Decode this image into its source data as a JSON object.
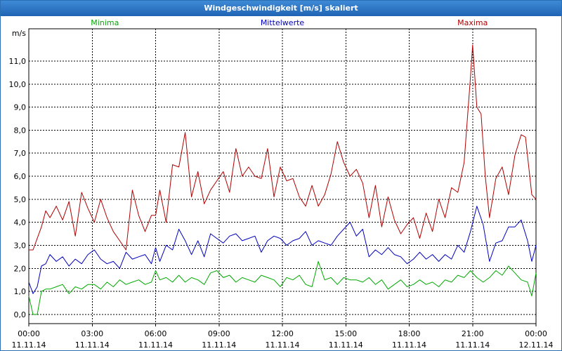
{
  "window": {
    "title": "Windgeschwindigkeit [m/s] skaliert"
  },
  "colors": {
    "minima": "#00aa00",
    "mittelwerte": "#0000c0",
    "maxima": "#b00000",
    "grid": "#000000"
  },
  "chart_data": {
    "type": "line",
    "title": "Windgeschwindigkeit [m/s] skaliert",
    "ylabel": "m/s",
    "xlabel": "",
    "ylim": [
      -0.4,
      12.4
    ],
    "xlim": [
      0,
      24
    ],
    "yticks": [
      0,
      1,
      2,
      3,
      4,
      5,
      6,
      7,
      8,
      9,
      10,
      11
    ],
    "ytick_labels": [
      "0,0",
      "1,0",
      "2,0",
      "3,0",
      "4,0",
      "5,0",
      "6,0",
      "7,0",
      "8,0",
      "9,0",
      "10,0",
      "11,0"
    ],
    "xticks": [
      0,
      3,
      6,
      9,
      12,
      15,
      18,
      21,
      24
    ],
    "xtick_time_labels": [
      "00:00",
      "03:00",
      "06:00",
      "09:00",
      "12:00",
      "15:00",
      "18:00",
      "21:00",
      "00:00"
    ],
    "xtick_date_labels": [
      "11.11.14",
      "11.11.14",
      "11.11.14",
      "11.11.14",
      "11.11.14",
      "11.11.14",
      "11.11.14",
      "11.11.14",
      "12.11.14"
    ],
    "grid": true,
    "series": [
      {
        "name": "Minima",
        "color": "#00aa00",
        "legend_position": "left",
        "x": [
          0,
          0.2,
          0.4,
          0.6,
          0.8,
          1.0,
          1.3,
          1.6,
          1.9,
          2.2,
          2.5,
          2.8,
          3.1,
          3.4,
          3.7,
          4.0,
          4.3,
          4.6,
          4.9,
          5.2,
          5.5,
          5.8,
          6.0,
          6.2,
          6.5,
          6.8,
          7.1,
          7.4,
          7.7,
          8.0,
          8.3,
          8.6,
          8.9,
          9.2,
          9.5,
          9.8,
          10.1,
          10.4,
          10.7,
          11.0,
          11.3,
          11.6,
          11.9,
          12.2,
          12.5,
          12.8,
          13.1,
          13.4,
          13.7,
          14.0,
          14.3,
          14.6,
          14.9,
          15.2,
          15.5,
          15.8,
          16.1,
          16.4,
          16.7,
          17.0,
          17.3,
          17.6,
          17.9,
          18.2,
          18.5,
          18.8,
          19.1,
          19.4,
          19.7,
          20.0,
          20.3,
          20.6,
          20.9,
          21.2,
          21.5,
          21.8,
          22.1,
          22.4,
          22.7,
          23.0,
          23.3,
          23.6,
          23.8,
          24.0
        ],
        "values": [
          0.8,
          0,
          0,
          1.0,
          1.1,
          1.1,
          1.2,
          1.3,
          0.9,
          1.2,
          1.1,
          1.3,
          1.3,
          1.1,
          1.4,
          1.2,
          1.5,
          1.3,
          1.4,
          1.5,
          1.3,
          1.4,
          1.9,
          1.5,
          1.6,
          1.4,
          1.7,
          1.4,
          1.6,
          1.5,
          1.3,
          1.8,
          1.9,
          1.6,
          1.7,
          1.4,
          1.6,
          1.5,
          1.4,
          1.7,
          1.6,
          1.5,
          1.2,
          1.6,
          1.5,
          1.7,
          1.3,
          1.2,
          2.3,
          1.5,
          1.6,
          1.3,
          1.6,
          1.5,
          1.5,
          1.4,
          1.6,
          1.3,
          1.5,
          1.1,
          1.3,
          1.5,
          1.2,
          1.3,
          1.5,
          1.3,
          1.4,
          1.2,
          1.5,
          1.4,
          1.7,
          1.6,
          1.9,
          1.6,
          1.4,
          1.6,
          1.9,
          1.7,
          2.1,
          1.8,
          1.5,
          1.4,
          0.8,
          1.8
        ]
      },
      {
        "name": "Mittelwerte",
        "color": "#0000c0",
        "legend_position": "center",
        "x": [
          0,
          0.2,
          0.4,
          0.6,
          0.8,
          1.0,
          1.3,
          1.6,
          1.9,
          2.2,
          2.5,
          2.8,
          3.1,
          3.4,
          3.7,
          4.0,
          4.3,
          4.6,
          4.9,
          5.2,
          5.5,
          5.8,
          6.0,
          6.2,
          6.5,
          6.8,
          7.1,
          7.4,
          7.7,
          8.0,
          8.3,
          8.6,
          8.9,
          9.2,
          9.5,
          9.8,
          10.1,
          10.4,
          10.7,
          11.0,
          11.3,
          11.6,
          11.9,
          12.2,
          12.5,
          12.8,
          13.1,
          13.4,
          13.7,
          14.0,
          14.3,
          14.6,
          14.9,
          15.2,
          15.5,
          15.8,
          16.1,
          16.4,
          16.7,
          17.0,
          17.3,
          17.6,
          17.9,
          18.2,
          18.5,
          18.8,
          19.1,
          19.4,
          19.7,
          20.0,
          20.3,
          20.6,
          20.9,
          21.2,
          21.5,
          21.8,
          22.1,
          22.4,
          22.7,
          23.0,
          23.3,
          23.6,
          23.8,
          24.0
        ],
        "values": [
          1.4,
          0.9,
          1.2,
          2.1,
          2.2,
          2.6,
          2.3,
          2.5,
          2.1,
          2.4,
          2.2,
          2.6,
          2.8,
          2.4,
          2.2,
          2.3,
          2.0,
          2.7,
          2.4,
          2.5,
          2.6,
          2.2,
          2.9,
          2.3,
          3.0,
          2.8,
          3.7,
          3.2,
          2.6,
          3.2,
          2.5,
          3.5,
          3.3,
          3.1,
          3.4,
          3.5,
          3.2,
          3.3,
          3.4,
          2.7,
          3.2,
          3.4,
          3.3,
          3.0,
          3.2,
          3.3,
          3.6,
          3.0,
          3.2,
          3.1,
          3.0,
          3.4,
          3.7,
          4.0,
          3.4,
          3.7,
          2.5,
          2.8,
          2.6,
          2.9,
          2.6,
          2.5,
          2.2,
          2.4,
          2.7,
          2.4,
          2.6,
          2.3,
          2.6,
          2.4,
          3.0,
          2.7,
          3.6,
          4.7,
          3.9,
          2.3,
          3.1,
          3.2,
          3.8,
          3.8,
          4.1,
          3.2,
          2.3,
          3.0
        ]
      },
      {
        "name": "Maxima",
        "color": "#b00000",
        "legend_position": "right",
        "x": [
          0,
          0.2,
          0.4,
          0.6,
          0.8,
          1.0,
          1.3,
          1.6,
          1.9,
          2.2,
          2.5,
          2.8,
          3.1,
          3.4,
          3.7,
          4.0,
          4.3,
          4.6,
          4.9,
          5.2,
          5.5,
          5.8,
          6.0,
          6.2,
          6.5,
          6.8,
          7.1,
          7.4,
          7.7,
          8.0,
          8.3,
          8.6,
          8.9,
          9.2,
          9.5,
          9.8,
          10.1,
          10.4,
          10.7,
          11.0,
          11.3,
          11.6,
          11.9,
          12.2,
          12.5,
          12.8,
          13.1,
          13.4,
          13.7,
          14.0,
          14.3,
          14.6,
          14.9,
          15.2,
          15.5,
          15.8,
          16.1,
          16.4,
          16.7,
          17.0,
          17.3,
          17.6,
          17.9,
          18.2,
          18.5,
          18.8,
          19.1,
          19.4,
          19.7,
          20.0,
          20.3,
          20.6,
          20.9,
          21.0,
          21.2,
          21.4,
          21.6,
          21.8,
          22.1,
          22.4,
          22.7,
          23.0,
          23.3,
          23.5,
          23.8,
          24.0
        ],
        "values": [
          2.8,
          2.8,
          3.3,
          3.8,
          4.5,
          4.2,
          4.7,
          4.1,
          4.9,
          3.4,
          5.3,
          4.6,
          4.0,
          5.0,
          4.2,
          3.6,
          3.2,
          2.8,
          5.4,
          4.3,
          3.6,
          4.3,
          4.3,
          5.4,
          4.0,
          6.5,
          6.4,
          7.9,
          5.1,
          6.2,
          4.8,
          5.4,
          5.8,
          6.2,
          5.3,
          7.2,
          6.0,
          6.4,
          6.0,
          5.9,
          7.2,
          5.1,
          6.4,
          5.8,
          5.9,
          5.1,
          4.7,
          5.6,
          4.7,
          5.2,
          6.1,
          7.5,
          6.6,
          6.0,
          6.3,
          5.7,
          4.2,
          5.6,
          3.8,
          5.1,
          4.1,
          3.5,
          3.9,
          4.2,
          3.3,
          4.4,
          3.6,
          5.0,
          4.2,
          5.5,
          5.3,
          6.6,
          10.3,
          11.7,
          9.0,
          8.7,
          6.0,
          4.2,
          5.9,
          6.4,
          5.2,
          6.9,
          7.8,
          7.7,
          5.2,
          5.0
        ]
      }
    ]
  }
}
